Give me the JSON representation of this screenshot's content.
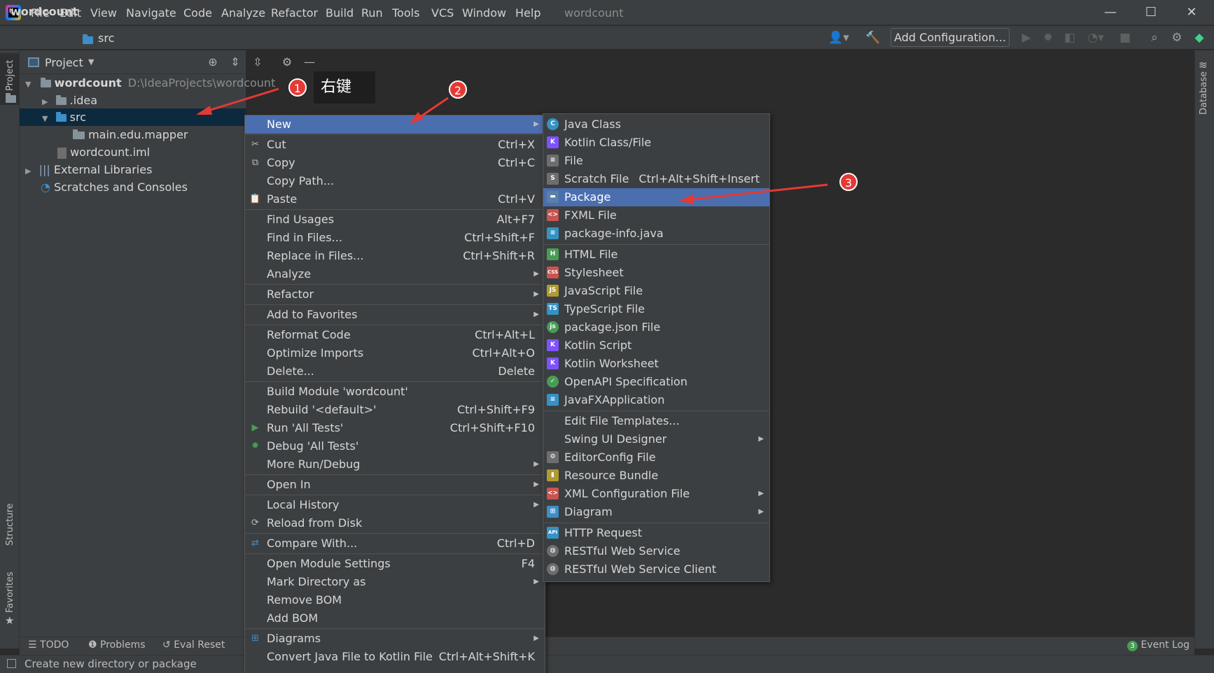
{
  "menubar": [
    "File",
    "Edit",
    "View",
    "Navigate",
    "Code",
    "Analyze",
    "Refactor",
    "Build",
    "Run",
    "Tools",
    "VCS",
    "Window",
    "Help"
  ],
  "window_title": "wordcount",
  "window_controls": {
    "minimize": "—",
    "maximize": "☐",
    "close": "✕"
  },
  "breadcrumb": {
    "project": "wordcount",
    "separator": "〉",
    "folder": "src"
  },
  "toolbar": {
    "add_configuration": "Add Configuration..."
  },
  "left_strip": {
    "project": "Project",
    "structure": "Structure",
    "favorites": "Favorites"
  },
  "right_strip": {
    "database": "Database"
  },
  "project_panel": {
    "title": "Project",
    "tree": {
      "root_name": "wordcount",
      "root_path": "D:\\IdeaProjects\\wordcount",
      "idea": ".idea",
      "src": "src",
      "package": "main.edu.mapper",
      "iml": "wordcount.iml",
      "external": "External Libraries",
      "scratches": "Scratches and Consoles"
    }
  },
  "context_menu": [
    {
      "label": "New",
      "shortcut": "",
      "submenu": true,
      "selected": true,
      "icon": ""
    },
    {
      "sep": true
    },
    {
      "label": "Cut",
      "shortcut": "Ctrl+X",
      "icon": "✂"
    },
    {
      "label": "Copy",
      "shortcut": "Ctrl+C",
      "icon": "⧉"
    },
    {
      "label": "Copy Path...",
      "shortcut": ""
    },
    {
      "label": "Paste",
      "shortcut": "Ctrl+V",
      "icon": "📋"
    },
    {
      "sep": true
    },
    {
      "label": "Find Usages",
      "shortcut": "Alt+F7"
    },
    {
      "label": "Find in Files...",
      "shortcut": "Ctrl+Shift+F"
    },
    {
      "label": "Replace in Files...",
      "shortcut": "Ctrl+Shift+R"
    },
    {
      "label": "Analyze",
      "submenu": true
    },
    {
      "sep": true
    },
    {
      "label": "Refactor",
      "submenu": true
    },
    {
      "sep": true
    },
    {
      "label": "Add to Favorites",
      "submenu": true
    },
    {
      "sep": true
    },
    {
      "label": "Reformat Code",
      "shortcut": "Ctrl+Alt+L"
    },
    {
      "label": "Optimize Imports",
      "shortcut": "Ctrl+Alt+O"
    },
    {
      "label": "Delete...",
      "shortcut": "Delete"
    },
    {
      "sep": true
    },
    {
      "label": "Build Module 'wordcount'",
      "shortcut": ""
    },
    {
      "label": "Rebuild '<default>'",
      "shortcut": "Ctrl+Shift+F9"
    },
    {
      "label": "Run 'All Tests'",
      "shortcut": "Ctrl+Shift+F10",
      "icon": "▶",
      "icon_color": "#499c54"
    },
    {
      "label": "Debug 'All Tests'",
      "shortcut": "",
      "icon": "✹",
      "icon_color": "#499c54"
    },
    {
      "label": "More Run/Debug",
      "submenu": true
    },
    {
      "sep": true
    },
    {
      "label": "Open In",
      "submenu": true
    },
    {
      "sep": true
    },
    {
      "label": "Local History",
      "submenu": true
    },
    {
      "label": "Reload from Disk",
      "icon": "⟳"
    },
    {
      "sep": true
    },
    {
      "label": "Compare With...",
      "shortcut": "Ctrl+D",
      "icon": "⇄",
      "icon_color": "#3d8ec9"
    },
    {
      "sep": true
    },
    {
      "label": "Open Module Settings",
      "shortcut": "F4"
    },
    {
      "label": "Mark Directory as",
      "submenu": true
    },
    {
      "label": "Remove BOM"
    },
    {
      "label": "Add BOM"
    },
    {
      "sep": true
    },
    {
      "label": "Diagrams",
      "submenu": true,
      "icon": "⊞",
      "icon_color": "#3d8ec9"
    },
    {
      "label": "Convert Java File to Kotlin File",
      "shortcut": "Ctrl+Alt+Shift+K"
    }
  ],
  "submenu": [
    {
      "label": "Java Class",
      "icon": "C",
      "color": "#3592c4",
      "round": true
    },
    {
      "label": "Kotlin Class/File",
      "icon": "K",
      "color": "#7f52ff"
    },
    {
      "label": "File",
      "icon": "≡",
      "color": "#6e6e6e"
    },
    {
      "label": "Scratch File",
      "shortcut": "Ctrl+Alt+Shift+Insert",
      "icon": "S",
      "color": "#6e6e6e"
    },
    {
      "label": "Package",
      "icon": "▬",
      "color": "#5a7fa8",
      "selected": true
    },
    {
      "label": "FXML File",
      "icon": "<>",
      "color": "#c75450"
    },
    {
      "label": "package-info.java",
      "icon": "≡",
      "color": "#3592c4"
    },
    {
      "sep": true
    },
    {
      "label": "HTML File",
      "icon": "H",
      "color": "#499c54"
    },
    {
      "label": "Stylesheet",
      "icon": "CSS",
      "color": "#c75450"
    },
    {
      "label": "JavaScript File",
      "icon": "JS",
      "color": "#b09a32"
    },
    {
      "label": "TypeScript File",
      "icon": "TS",
      "color": "#3592c4"
    },
    {
      "label": "package.json File",
      "icon": "js",
      "color": "#499c54",
      "round": true
    },
    {
      "label": "Kotlin Script",
      "icon": "K",
      "color": "#7f52ff"
    },
    {
      "label": "Kotlin Worksheet",
      "icon": "K",
      "color": "#7f52ff"
    },
    {
      "label": "OpenAPI Specification",
      "icon": "✓",
      "color": "#499c54",
      "round": true
    },
    {
      "label": "JavaFXApplication",
      "icon": "≡",
      "color": "#3592c4"
    },
    {
      "sep": true
    },
    {
      "label": "Edit File Templates..."
    },
    {
      "label": "Swing UI Designer",
      "submenu": true
    },
    {
      "label": "EditorConfig File",
      "icon": "⚙",
      "color": "#6e6e6e"
    },
    {
      "label": "Resource Bundle",
      "icon": "▮",
      "color": "#b09a32"
    },
    {
      "label": "XML Configuration File",
      "icon": "<>",
      "color": "#c75450",
      "submenu": true
    },
    {
      "label": "Diagram",
      "icon": "⊞",
      "color": "#3d8ec9",
      "submenu": true
    },
    {
      "sep": true
    },
    {
      "label": "HTTP Request",
      "icon": "API",
      "color": "#3592c4"
    },
    {
      "label": "RESTful Web Service",
      "icon": "◍",
      "color": "#6e6e6e",
      "round": true
    },
    {
      "label": "RESTful Web Service Client",
      "icon": "◍",
      "color": "#6e6e6e",
      "round": true
    }
  ],
  "bottom_tabs": {
    "todo": "TODO",
    "problems": "Problems",
    "eval_reset": "Eval Reset",
    "event_log": "Event Log",
    "event_count": "3"
  },
  "status": {
    "text": "Create new directory or package"
  },
  "annotations": {
    "badge1": "1",
    "badge2": "2",
    "badge3": "3",
    "note": "右键"
  }
}
